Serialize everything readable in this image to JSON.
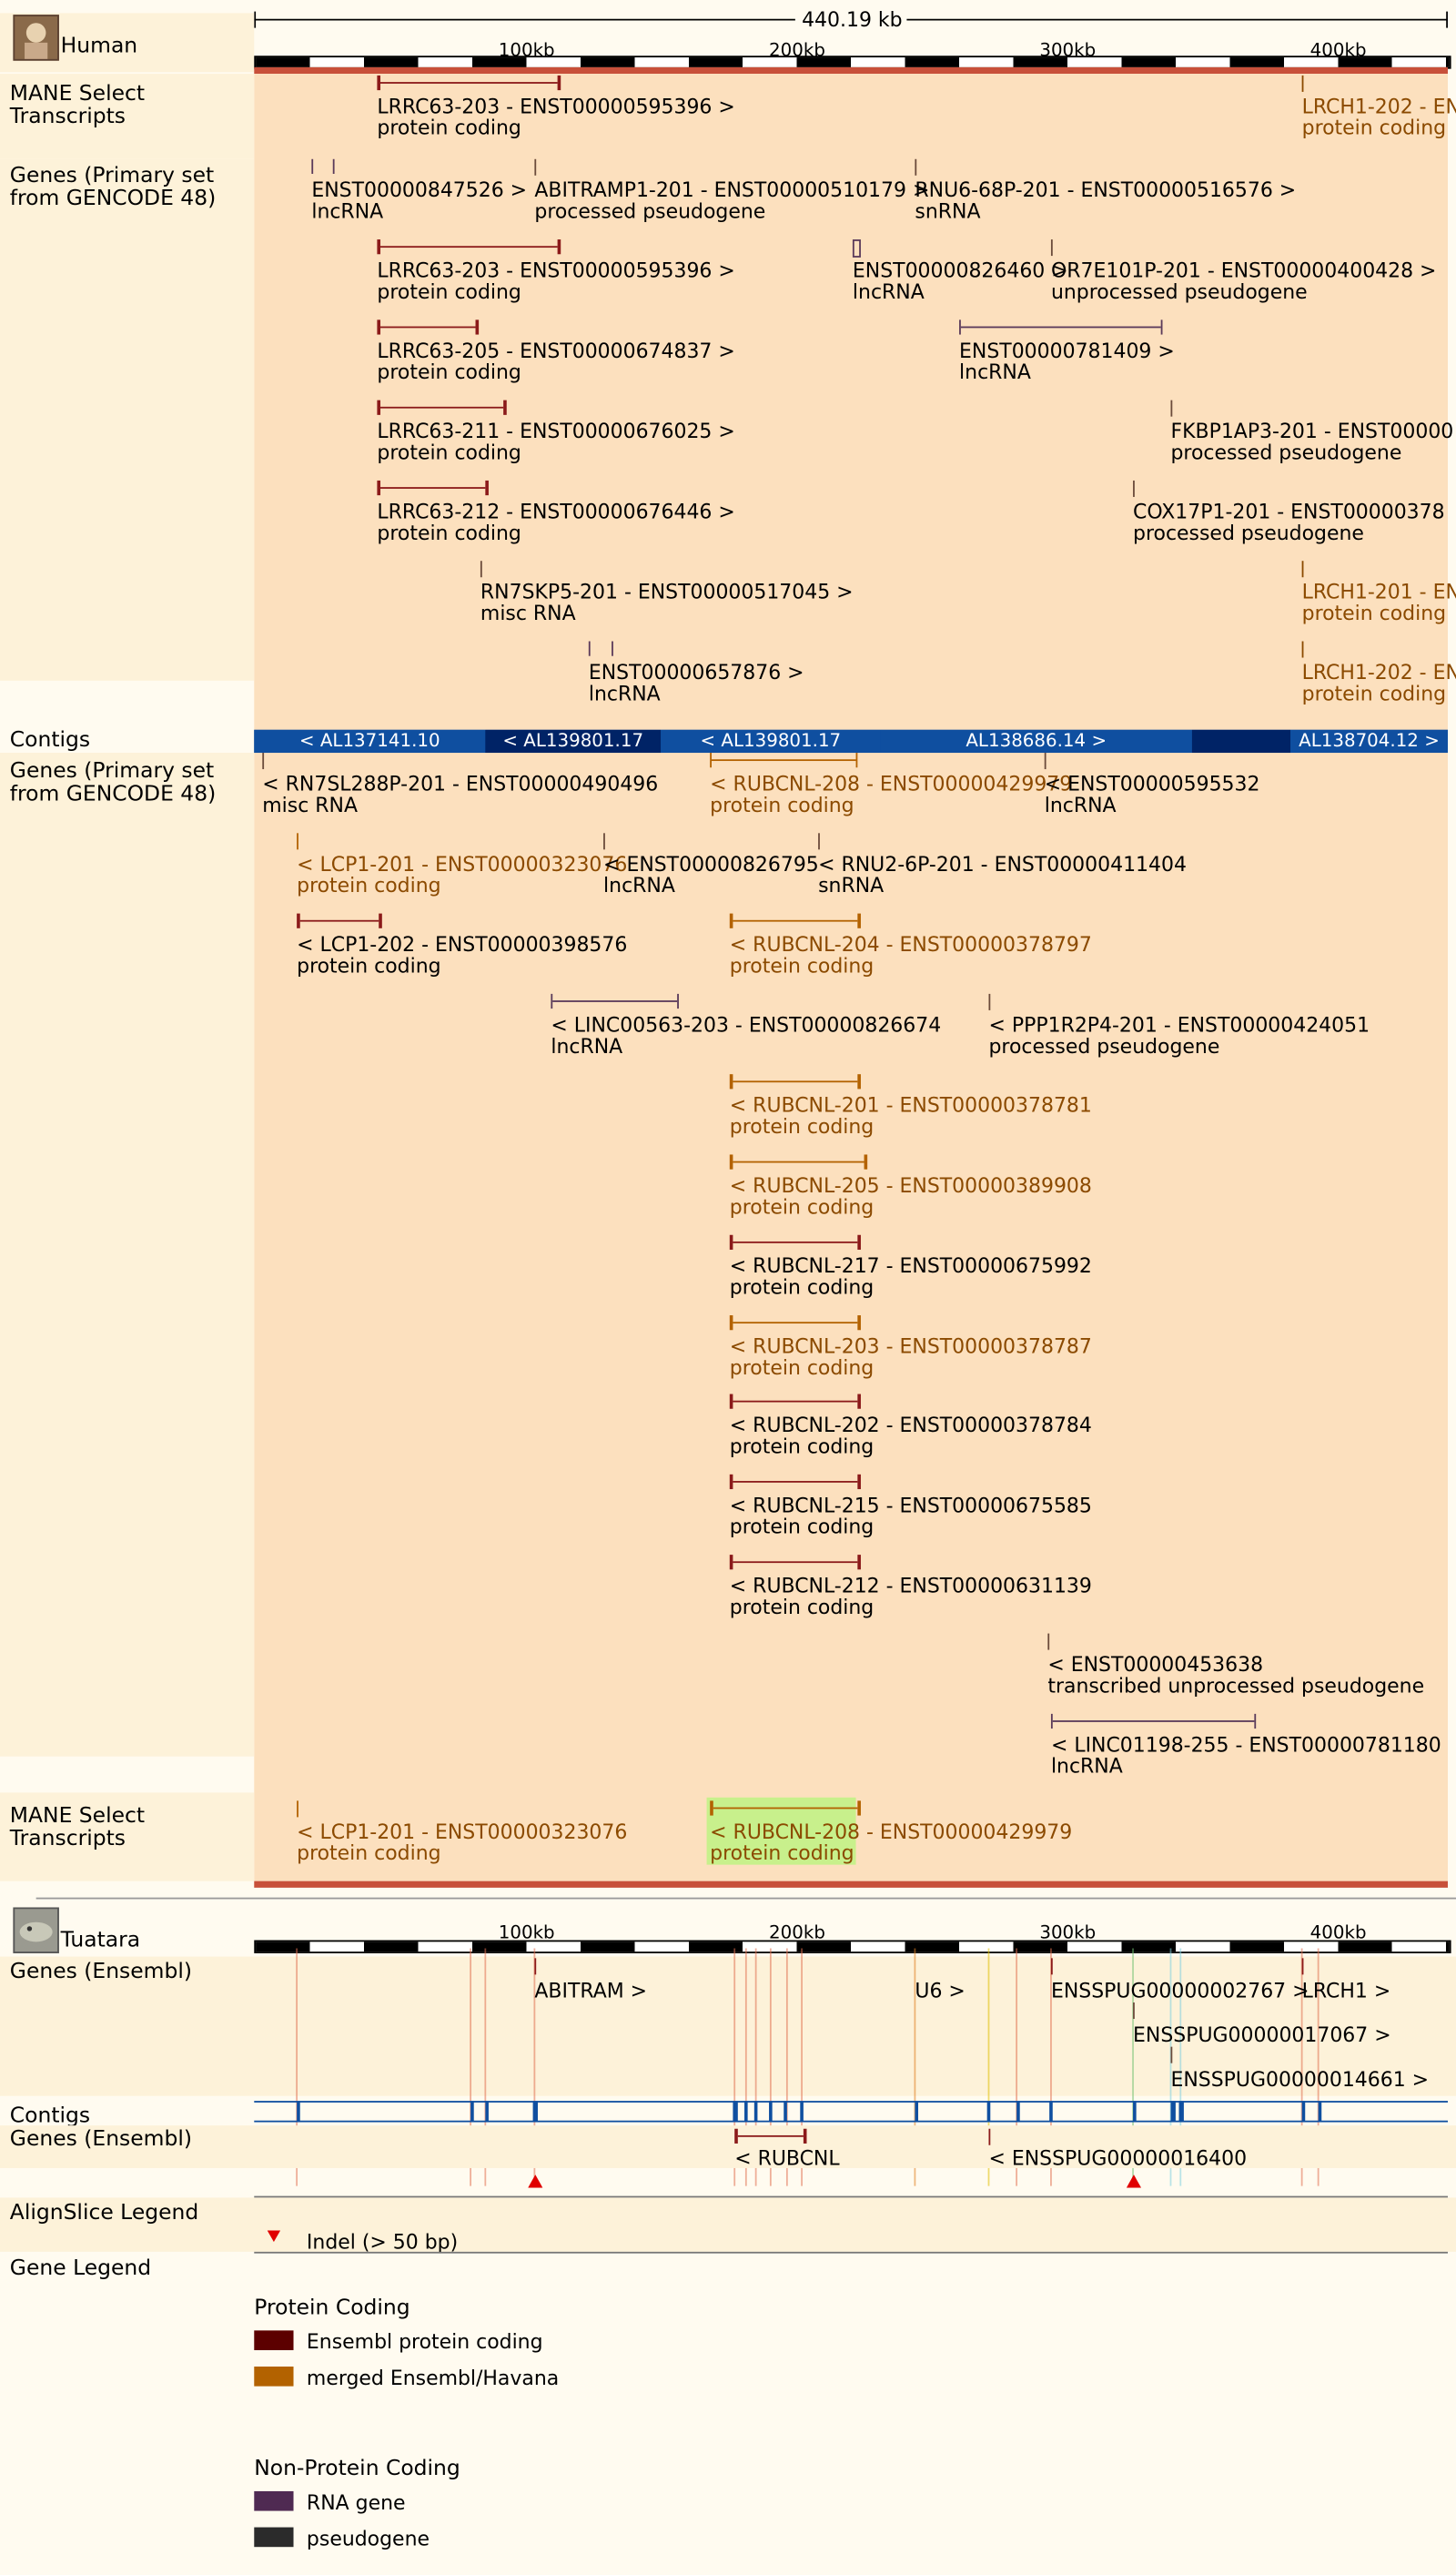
{
  "human": {
    "species": "Human",
    "scale_label": "440.19 kb",
    "ruler_ticks": [
      "100kb",
      "200kb",
      "300kb",
      "400kb"
    ],
    "tracks": {
      "mane_top": "MANE Select\nTranscripts",
      "genes_top": "Genes (Primary set\nfrom GENCODE 48)",
      "contigs": "Contigs",
      "genes_bottom": "Genes (Primary set\nfrom GENCODE 48)",
      "mane_bottom": "MANE Select\nTranscripts"
    },
    "mane_top_items": [
      {
        "name": "LRRC63-203 - ENST00000595396 >",
        "type": "protein coding"
      },
      {
        "name": "LRCH1-202 - ENS",
        "type": "protein coding"
      }
    ],
    "genes_top_items": [
      {
        "name": "ENST00000847526 >",
        "type": "lncRNA"
      },
      {
        "name": "ABITRAMP1-201 - ENST00000510179 >",
        "type": "processed pseudogene"
      },
      {
        "name": "RNU6-68P-201 - ENST00000516576 >",
        "type": "snRNA"
      },
      {
        "name": "LRRC63-203 - ENST00000595396 >",
        "type": "protein coding"
      },
      {
        "name": "ENST00000826460 >",
        "type": "lncRNA"
      },
      {
        "name": "OR7E101P-201 - ENST00000400428 >",
        "type": "unprocessed pseudogene"
      },
      {
        "name": "LRRC63-205 - ENST00000674837 >",
        "type": "protein coding"
      },
      {
        "name": "ENST00000781409 >",
        "type": "lncRNA"
      },
      {
        "name": "LRRC63-211 - ENST00000676025 >",
        "type": "protein coding"
      },
      {
        "name": "FKBP1AP3-201 - ENST00000",
        "type": "processed pseudogene"
      },
      {
        "name": "LRRC63-212 - ENST00000676446 >",
        "type": "protein coding"
      },
      {
        "name": "COX17P1-201 - ENST00000378",
        "type": "processed pseudogene"
      },
      {
        "name": "RN7SKP5-201 - ENST00000517045 >",
        "type": "misc RNA"
      },
      {
        "name": "LRCH1-201 - EN",
        "type": "protein coding"
      },
      {
        "name": "ENST00000657876 >",
        "type": "lncRNA"
      },
      {
        "name": "LRCH1-202 - EN",
        "type": "protein coding"
      }
    ],
    "contigs_items": [
      "< AL137141.10",
      "< AL139801.17",
      "< AL139801.17",
      "AL138686.14 >",
      "AL138704.12 >"
    ],
    "genes_bottom_items": [
      {
        "name": "< RN7SL288P-201 - ENST00000490496",
        "type": "misc RNA"
      },
      {
        "name": "< RUBCNL-208 - ENST00000429979",
        "type": "protein coding"
      },
      {
        "name": "< ENST00000595532",
        "type": "lncRNA"
      },
      {
        "name": "< LCP1-201 - ENST00000323076",
        "type": "protein coding"
      },
      {
        "name": "< ENST00000826795",
        "type": "lncRNA"
      },
      {
        "name": "< RNU2-6P-201 - ENST00000411404",
        "type": "snRNA"
      },
      {
        "name": "< LCP1-202 - ENST00000398576",
        "type": "protein coding"
      },
      {
        "name": "< RUBCNL-204 - ENST00000378797",
        "type": "protein coding"
      },
      {
        "name": "< LINC00563-203 - ENST00000826674",
        "type": "lncRNA"
      },
      {
        "name": "< PPP1R2P4-201 - ENST00000424051",
        "type": "processed pseudogene"
      },
      {
        "name": "< RUBCNL-201 - ENST00000378781",
        "type": "protein coding"
      },
      {
        "name": "< RUBCNL-205 - ENST00000389908",
        "type": "protein coding"
      },
      {
        "name": "< RUBCNL-217 - ENST00000675992",
        "type": "protein coding"
      },
      {
        "name": "< RUBCNL-203 - ENST00000378787",
        "type": "protein coding"
      },
      {
        "name": "< RUBCNL-202 - ENST00000378784",
        "type": "protein coding"
      },
      {
        "name": "< RUBCNL-215 - ENST00000675585",
        "type": "protein coding"
      },
      {
        "name": "< RUBCNL-212 - ENST00000631139",
        "type": "protein coding"
      },
      {
        "name": "< ENST00000453638",
        "type": "transcribed unprocessed pseudogene"
      },
      {
        "name": "< LINC01198-255 - ENST00000781180",
        "type": "lncRNA"
      }
    ],
    "mane_bottom_items": [
      {
        "name": "< LCP1-201 - ENST00000323076",
        "type": "protein coding"
      },
      {
        "name": "< RUBCNL-208 - ENST00000429979",
        "type": "protein coding"
      }
    ]
  },
  "tuatara": {
    "species": "Tuatara",
    "ruler_ticks": [
      "100kb",
      "200kb",
      "300kb",
      "400kb"
    ],
    "tracks": {
      "genes_top": "Genes (Ensembl)",
      "contigs": "Contigs",
      "genes_bottom": "Genes (Ensembl)"
    },
    "genes_top_items": [
      "ABITRAM >",
      "U6 >",
      "ENSSPUG00000002767 >",
      "LRCH1 >",
      "ENSSPUG00000017067 >",
      "ENSSPUG00000014661 >"
    ],
    "genes_bottom_items": [
      "< RUBCNL",
      "< ENSSPUG00000016400"
    ]
  },
  "legend": {
    "alignslice_label": "AlignSlice Legend",
    "indel_text": "Indel (> 50 bp)",
    "gene_legend_label": "Gene Legend",
    "protein_coding_heading": "Protein Coding",
    "protein_items": [
      {
        "label": "Ensembl protein coding",
        "color": "#5c0000"
      },
      {
        "label": "merged Ensembl/Havana",
        "color": "#b36200"
      }
    ],
    "nonprotein_heading": "Non-Protein Coding",
    "nonprotein_items": [
      {
        "label": "RNA gene",
        "color": "#4f2a52"
      },
      {
        "label": "pseudogene",
        "color": "#2b2b2b"
      }
    ]
  },
  "colors": {
    "peach": "#fce0be",
    "band": "#fdf2d9",
    "contig_dark": "#002366",
    "contig_mid": "#0f4fa0",
    "red_bar": "#c8503a"
  }
}
